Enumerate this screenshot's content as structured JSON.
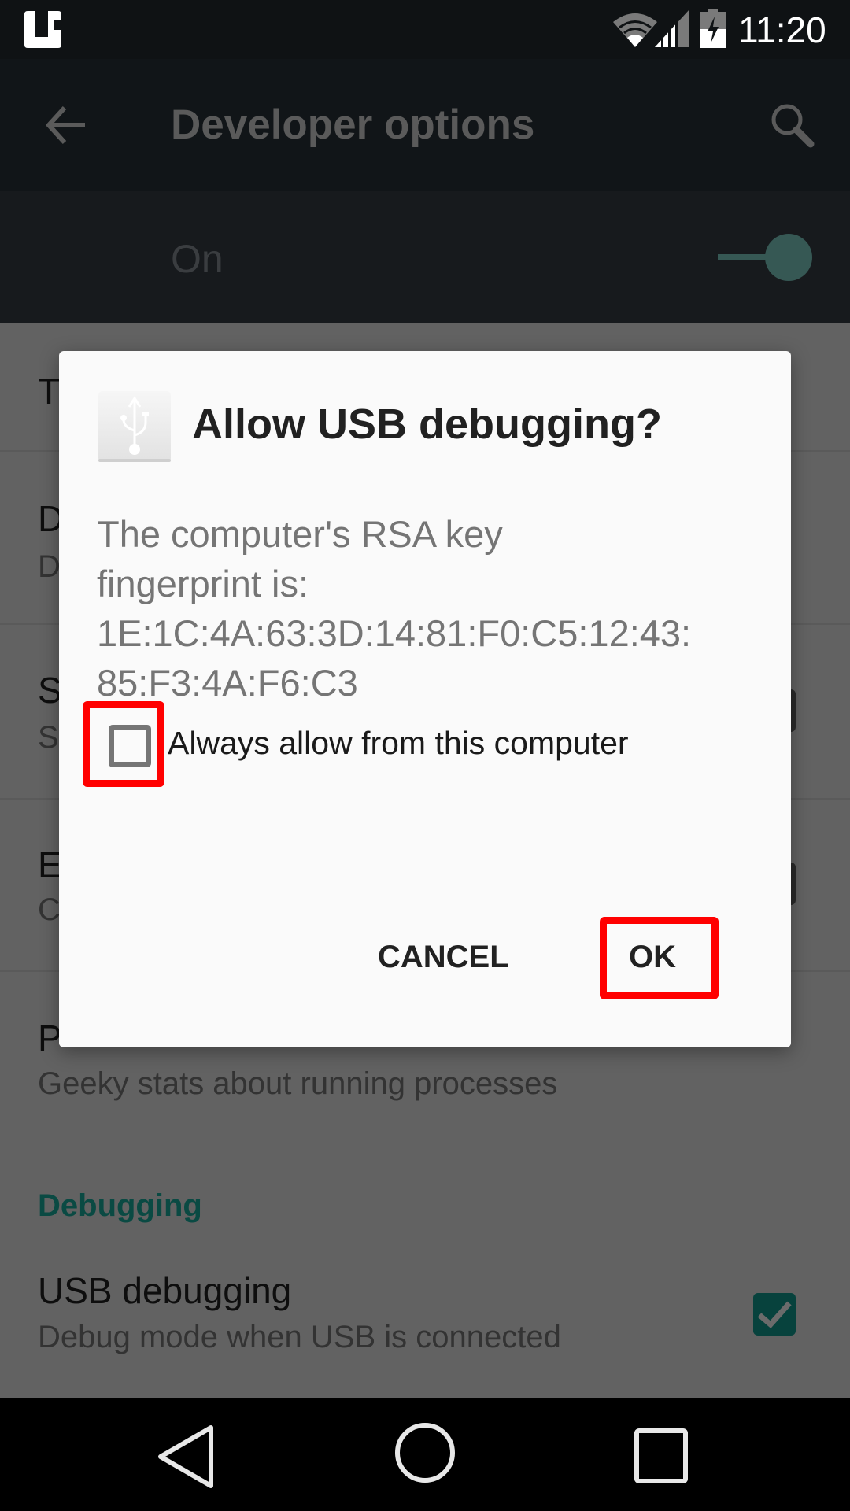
{
  "status_bar": {
    "time": "11:20",
    "icons": [
      "notification-app-icon",
      "wifi-icon",
      "cell-signal-icon",
      "battery-charging-icon"
    ]
  },
  "toolbar": {
    "back_icon": "arrow-left",
    "title": "Developer options",
    "search_icon": "magnifier"
  },
  "master_switch": {
    "label": "On",
    "state": "on",
    "accent_color": "#365854"
  },
  "background_list": {
    "items": [
      {
        "title": "T",
        "subtitle": ""
      },
      {
        "title": "D",
        "subtitle": "D"
      },
      {
        "title": "S",
        "subtitle": "S"
      },
      {
        "title": "E",
        "subtitle": "C"
      },
      {
        "title": "P",
        "subtitle": "Geeky stats about running processes"
      }
    ],
    "section_header": "Debugging",
    "usb_debugging": {
      "title": "USB debugging",
      "subtitle": "Debug mode when USB is connected",
      "checked": true
    }
  },
  "dialog": {
    "icon": "usb-icon",
    "title": "Allow USB debugging?",
    "body_lines": [
      "The computer's RSA key",
      "fingerprint is:",
      "1E:1C:4A:63:3D:14:81:F0:C5:12:43:",
      "85:F3:4A:F6:C3"
    ],
    "always_allow": {
      "label": "Always allow from this computer",
      "checked": false
    },
    "cancel_label": "CANCEL",
    "ok_label": "OK",
    "highlight_color": "#ff0000"
  },
  "nav_bar": {
    "back": "triangle-back",
    "home": "circle-home",
    "recents": "square-recents"
  }
}
